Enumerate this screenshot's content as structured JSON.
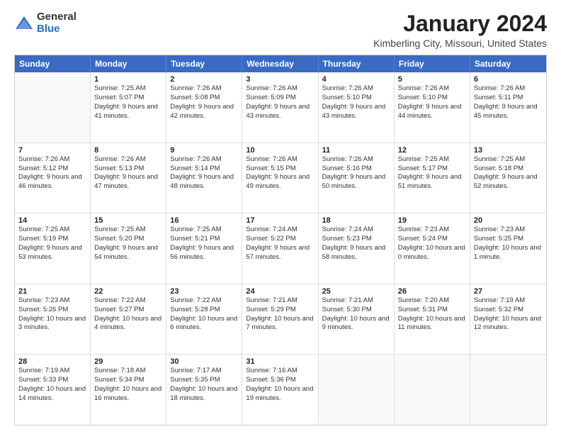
{
  "logo": {
    "general": "General",
    "blue": "Blue"
  },
  "title": "January 2024",
  "subtitle": "Kimberling City, Missouri, United States",
  "header_days": [
    "Sunday",
    "Monday",
    "Tuesday",
    "Wednesday",
    "Thursday",
    "Friday",
    "Saturday"
  ],
  "rows": [
    [
      {
        "num": "",
        "sunrise": "",
        "sunset": "",
        "daylight": "",
        "empty": true
      },
      {
        "num": "1",
        "sunrise": "Sunrise: 7:25 AM",
        "sunset": "Sunset: 5:07 PM",
        "daylight": "Daylight: 9 hours and 41 minutes."
      },
      {
        "num": "2",
        "sunrise": "Sunrise: 7:26 AM",
        "sunset": "Sunset: 5:08 PM",
        "daylight": "Daylight: 9 hours and 42 minutes."
      },
      {
        "num": "3",
        "sunrise": "Sunrise: 7:26 AM",
        "sunset": "Sunset: 5:09 PM",
        "daylight": "Daylight: 9 hours and 43 minutes."
      },
      {
        "num": "4",
        "sunrise": "Sunrise: 7:26 AM",
        "sunset": "Sunset: 5:10 PM",
        "daylight": "Daylight: 9 hours and 43 minutes."
      },
      {
        "num": "5",
        "sunrise": "Sunrise: 7:26 AM",
        "sunset": "Sunset: 5:10 PM",
        "daylight": "Daylight: 9 hours and 44 minutes."
      },
      {
        "num": "6",
        "sunrise": "Sunrise: 7:26 AM",
        "sunset": "Sunset: 5:11 PM",
        "daylight": "Daylight: 9 hours and 45 minutes."
      }
    ],
    [
      {
        "num": "7",
        "sunrise": "Sunrise: 7:26 AM",
        "sunset": "Sunset: 5:12 PM",
        "daylight": "Daylight: 9 hours and 46 minutes."
      },
      {
        "num": "8",
        "sunrise": "Sunrise: 7:26 AM",
        "sunset": "Sunset: 5:13 PM",
        "daylight": "Daylight: 9 hours and 47 minutes."
      },
      {
        "num": "9",
        "sunrise": "Sunrise: 7:26 AM",
        "sunset": "Sunset: 5:14 PM",
        "daylight": "Daylight: 9 hours and 48 minutes."
      },
      {
        "num": "10",
        "sunrise": "Sunrise: 7:26 AM",
        "sunset": "Sunset: 5:15 PM",
        "daylight": "Daylight: 9 hours and 49 minutes."
      },
      {
        "num": "11",
        "sunrise": "Sunrise: 7:26 AM",
        "sunset": "Sunset: 5:16 PM",
        "daylight": "Daylight: 9 hours and 50 minutes."
      },
      {
        "num": "12",
        "sunrise": "Sunrise: 7:25 AM",
        "sunset": "Sunset: 5:17 PM",
        "daylight": "Daylight: 9 hours and 51 minutes."
      },
      {
        "num": "13",
        "sunrise": "Sunrise: 7:25 AM",
        "sunset": "Sunset: 5:18 PM",
        "daylight": "Daylight: 9 hours and 52 minutes."
      }
    ],
    [
      {
        "num": "14",
        "sunrise": "Sunrise: 7:25 AM",
        "sunset": "Sunset: 5:19 PM",
        "daylight": "Daylight: 9 hours and 53 minutes."
      },
      {
        "num": "15",
        "sunrise": "Sunrise: 7:25 AM",
        "sunset": "Sunset: 5:20 PM",
        "daylight": "Daylight: 9 hours and 54 minutes."
      },
      {
        "num": "16",
        "sunrise": "Sunrise: 7:25 AM",
        "sunset": "Sunset: 5:21 PM",
        "daylight": "Daylight: 9 hours and 56 minutes."
      },
      {
        "num": "17",
        "sunrise": "Sunrise: 7:24 AM",
        "sunset": "Sunset: 5:22 PM",
        "daylight": "Daylight: 9 hours and 57 minutes."
      },
      {
        "num": "18",
        "sunrise": "Sunrise: 7:24 AM",
        "sunset": "Sunset: 5:23 PM",
        "daylight": "Daylight: 9 hours and 58 minutes."
      },
      {
        "num": "19",
        "sunrise": "Sunrise: 7:23 AM",
        "sunset": "Sunset: 5:24 PM",
        "daylight": "Daylight: 10 hours and 0 minutes."
      },
      {
        "num": "20",
        "sunrise": "Sunrise: 7:23 AM",
        "sunset": "Sunset: 5:25 PM",
        "daylight": "Daylight: 10 hours and 1 minute."
      }
    ],
    [
      {
        "num": "21",
        "sunrise": "Sunrise: 7:23 AM",
        "sunset": "Sunset: 5:26 PM",
        "daylight": "Daylight: 10 hours and 3 minutes."
      },
      {
        "num": "22",
        "sunrise": "Sunrise: 7:22 AM",
        "sunset": "Sunset: 5:27 PM",
        "daylight": "Daylight: 10 hours and 4 minutes."
      },
      {
        "num": "23",
        "sunrise": "Sunrise: 7:22 AM",
        "sunset": "Sunset: 5:28 PM",
        "daylight": "Daylight: 10 hours and 6 minutes."
      },
      {
        "num": "24",
        "sunrise": "Sunrise: 7:21 AM",
        "sunset": "Sunset: 5:29 PM",
        "daylight": "Daylight: 10 hours and 7 minutes."
      },
      {
        "num": "25",
        "sunrise": "Sunrise: 7:21 AM",
        "sunset": "Sunset: 5:30 PM",
        "daylight": "Daylight: 10 hours and 9 minutes."
      },
      {
        "num": "26",
        "sunrise": "Sunrise: 7:20 AM",
        "sunset": "Sunset: 5:31 PM",
        "daylight": "Daylight: 10 hours and 11 minutes."
      },
      {
        "num": "27",
        "sunrise": "Sunrise: 7:19 AM",
        "sunset": "Sunset: 5:32 PM",
        "daylight": "Daylight: 10 hours and 12 minutes."
      }
    ],
    [
      {
        "num": "28",
        "sunrise": "Sunrise: 7:19 AM",
        "sunset": "Sunset: 5:33 PM",
        "daylight": "Daylight: 10 hours and 14 minutes."
      },
      {
        "num": "29",
        "sunrise": "Sunrise: 7:18 AM",
        "sunset": "Sunset: 5:34 PM",
        "daylight": "Daylight: 10 hours and 16 minutes."
      },
      {
        "num": "30",
        "sunrise": "Sunrise: 7:17 AM",
        "sunset": "Sunset: 5:35 PM",
        "daylight": "Daylight: 10 hours and 18 minutes."
      },
      {
        "num": "31",
        "sunrise": "Sunrise: 7:16 AM",
        "sunset": "Sunset: 5:36 PM",
        "daylight": "Daylight: 10 hours and 19 minutes."
      },
      {
        "num": "",
        "sunrise": "",
        "sunset": "",
        "daylight": "",
        "empty": true
      },
      {
        "num": "",
        "sunrise": "",
        "sunset": "",
        "daylight": "",
        "empty": true
      },
      {
        "num": "",
        "sunrise": "",
        "sunset": "",
        "daylight": "",
        "empty": true
      }
    ]
  ]
}
